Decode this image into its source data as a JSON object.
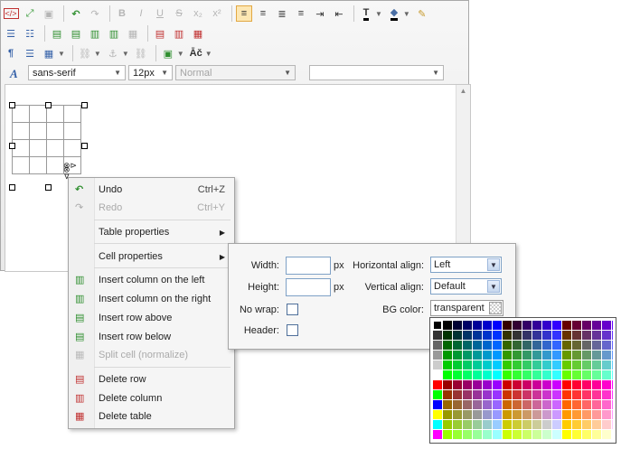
{
  "toolbar": {
    "font_family": "sans-serif",
    "font_size": "12px",
    "format": "Normal",
    "style": ""
  },
  "context_menu": {
    "items": [
      {
        "label": "Undo",
        "shortcut": "Ctrl+Z",
        "disabled": false,
        "icon": "undo-icon"
      },
      {
        "label": "Redo",
        "shortcut": "Ctrl+Y",
        "disabled": true,
        "icon": "redo-icon"
      },
      {
        "label": "Table properties",
        "submenu": true
      },
      {
        "label": "Cell properties",
        "submenu": true
      },
      {
        "label": "Insert column on the left",
        "icon": "insert-column-left-icon"
      },
      {
        "label": "Insert column on the right",
        "icon": "insert-column-right-icon"
      },
      {
        "label": "Insert row above",
        "icon": "insert-row-above-icon"
      },
      {
        "label": "Insert row below",
        "icon": "insert-row-below-icon"
      },
      {
        "label": "Split cell (normalize)",
        "disabled": true,
        "icon": "split-cell-icon"
      },
      {
        "label": "Delete row",
        "icon": "delete-row-icon"
      },
      {
        "label": "Delete column",
        "icon": "delete-column-icon"
      },
      {
        "label": "Delete table",
        "icon": "delete-table-icon"
      }
    ]
  },
  "cell_properties": {
    "width_label": "Width:",
    "width_value": "",
    "width_unit": "px",
    "height_label": "Height:",
    "height_value": "",
    "height_unit": "px",
    "nowrap_label": "No wrap:",
    "header_label": "Header:",
    "halign_label": "Horizontal align:",
    "halign_value": "Left",
    "valign_label": "Vertical align:",
    "valign_value": "Default",
    "bgcolor_label": "BG color:",
    "bgcolor_value": "transparent"
  },
  "colors": {
    "accent_active": "#fde7b3",
    "field_border": "#7ea1c6"
  }
}
